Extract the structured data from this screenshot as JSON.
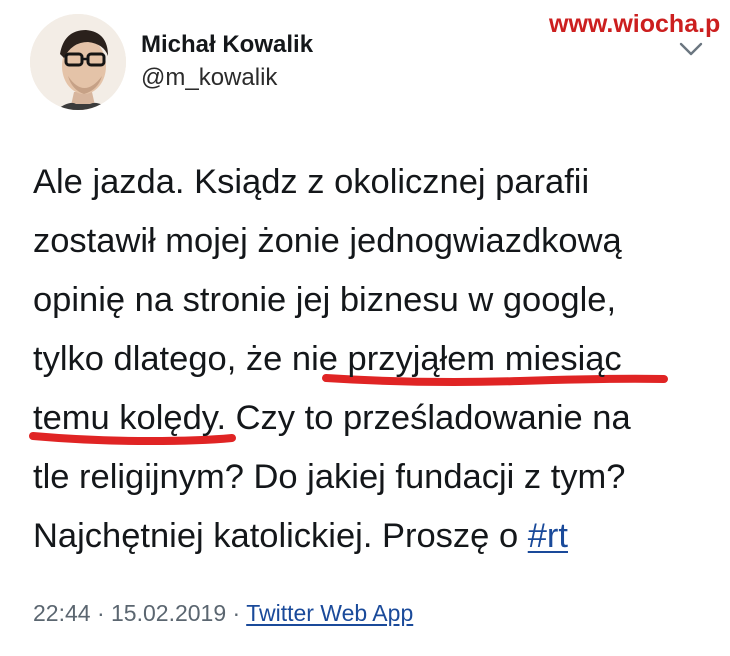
{
  "author": {
    "display_name": "Michał Kowalik",
    "handle": "@m_kowalik"
  },
  "watermark": {
    "text": "www.wiocha.pl"
  },
  "tweet": {
    "lines": [
      "Ale jazda. Ksiądz z okolicznej parafii",
      "zostawił mojej żonie jednogwiazdkową",
      "opinię na stronie jej biznesu w google,",
      "tylko dlatego, że nie przyjąłem miesiąc",
      "temu kolędy. Czy to prześladowanie na",
      "tle religijnym? Do jakiej fundacji z tym?"
    ],
    "last_line_prefix": "Najchętniej katolickiej. Proszę o ",
    "hashtag": "#rt"
  },
  "meta": {
    "time": "22:44",
    "separator": "·",
    "date": "15.02.2019",
    "source": "Twitter Web App"
  },
  "colors": {
    "text": "#14171a",
    "link": "#1a4a9a",
    "meta": "#5b6670",
    "highlight_marker": "#e02424",
    "watermark": "#cc1f1f"
  },
  "icons": {
    "caret": "chevron-down-icon"
  }
}
